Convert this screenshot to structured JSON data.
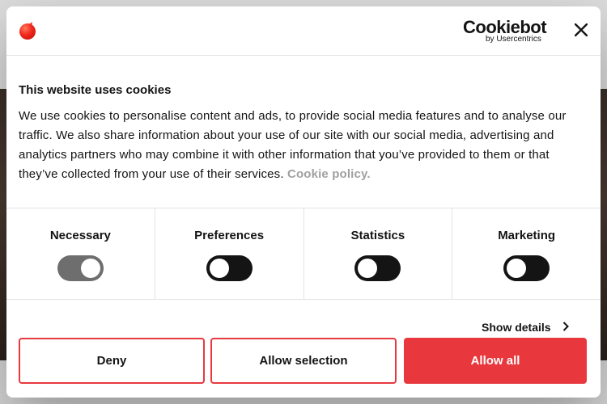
{
  "colors": {
    "accent": "#e8383e",
    "text": "#141414",
    "link_muted": "#a0a0a0",
    "toggle_off": "#141414",
    "toggle_on": "#6e6e6e"
  },
  "header": {
    "brand_icon": "red-sphere-logo",
    "provider_name": "Cookiebot",
    "provider_sub": "by Usercentrics",
    "close_icon": "close-icon"
  },
  "body": {
    "title": "This website uses cookies",
    "description": "We use cookies to personalise content and ads, to provide social media features and to analyse our traffic. We also share information about your use of our site with our social media, advertising and analytics partners who may combine it with other information that you’ve provided to them or that they’ve collected from your use of their services.",
    "policy_link": "Cookie policy."
  },
  "categories": [
    {
      "label": "Necessary",
      "enabled": true
    },
    {
      "label": "Preferences",
      "enabled": false
    },
    {
      "label": "Statistics",
      "enabled": false
    },
    {
      "label": "Marketing",
      "enabled": false
    }
  ],
  "details": {
    "label": "Show details",
    "icon": "chevron-right-icon"
  },
  "buttons": {
    "deny": "Deny",
    "allow_selection": "Allow selection",
    "allow_all": "Allow all"
  }
}
